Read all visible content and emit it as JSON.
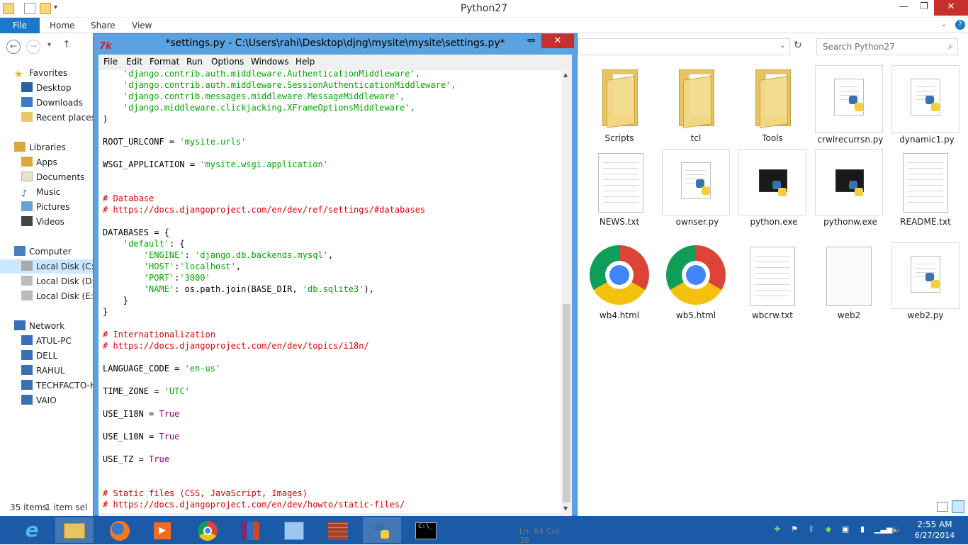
{
  "explorer": {
    "title": "Python27",
    "ribbon": {
      "file": "File",
      "tabs": [
        "Home",
        "Share",
        "View"
      ]
    },
    "search_placeholder": "Search Python27",
    "sidebar": {
      "favorites": {
        "label": "Favorites",
        "items": [
          "Desktop",
          "Downloads",
          "Recent places"
        ]
      },
      "libraries": {
        "label": "Libraries",
        "items": [
          "Apps",
          "Documents",
          "Music",
          "Pictures",
          "Videos"
        ]
      },
      "computer": {
        "label": "Computer",
        "items": [
          "Local Disk (C:)",
          "Local Disk (D:)",
          "Local Disk (E:)"
        ]
      },
      "network": {
        "label": "Network",
        "items": [
          "ATUL-PC",
          "DELL",
          "RAHUL",
          "TECHFACTO-H",
          "VAIO"
        ]
      }
    },
    "status": {
      "count": "35 items",
      "selected": "1 item sel"
    },
    "files": [
      {
        "name": "Scripts",
        "icon": "folder-icon"
      },
      {
        "name": "tcl",
        "icon": "folder-icon"
      },
      {
        "name": "Tools",
        "icon": "folder-icon"
      },
      {
        "name": "crwlrecurrsn.py",
        "icon": "python-file-icon"
      },
      {
        "name": "dynamic1.py",
        "icon": "python-file-icon"
      },
      {
        "name": "NEWS.txt",
        "icon": "text-file-icon"
      },
      {
        "name": "ownser.py",
        "icon": "python-file-icon"
      },
      {
        "name": "python.exe",
        "icon": "python-exe-icon"
      },
      {
        "name": "pythonw.exe",
        "icon": "python-exe-icon"
      },
      {
        "name": "README.txt",
        "icon": "text-file-icon"
      },
      {
        "name": "wb4.html",
        "icon": "chrome-icon"
      },
      {
        "name": "wb5.html",
        "icon": "chrome-icon"
      },
      {
        "name": "wbcrw.txt",
        "icon": "text-file-icon"
      },
      {
        "name": "web2",
        "icon": "blank-file-icon"
      },
      {
        "name": "web2.py",
        "icon": "python-file-icon"
      }
    ]
  },
  "idle": {
    "title": "*settings.py - C:\\Users\\rahi\\Desktop\\djng\\mysite\\mysite\\settings.py*",
    "menu": [
      "File",
      "Edit",
      "Format",
      "Run",
      "Options",
      "Windows",
      "Help"
    ],
    "status": "Ln: 64  Col: 38"
  },
  "code": {
    "l1": "'django.contrib.auth.middleware.AuthenticationMiddleware',",
    "l2": "'django.contrib.auth.middleware.SessionAuthenticationMiddleware',",
    "l3": "'django.contrib.messages.middleware.MessageMiddleware',",
    "l4": "'django.middleware.clickjacking.XFrameOptionsMiddleware',",
    "l5": ")",
    "root_k": "ROOT_URLCONF = ",
    "root_v": "'mysite.urls'",
    "wsgi_k": "WSGI_APPLICATION = ",
    "wsgi_v": "'mysite.wsgi.application'",
    "db_c1": "# Database",
    "db_c2": "# https://docs.djangoproject.com/en/dev/ref/settings/#databases",
    "db_open": "DATABASES = {",
    "default_k": "'default'",
    "default_rest": ": {",
    "engine_k": "'ENGINE'",
    "engine_sep": ": ",
    "engine_v": "'django.db.backends.mysql'",
    "engine_end": ",",
    "host_k": "'HOST'",
    "host_sep": ":",
    "host_v": "'localhost'",
    "host_end": ",",
    "port_k": "'PORT'",
    "port_sep": ":",
    "port_v": "'3000'",
    "name_k": "'NAME'",
    "name_mid": ": os.path.join(BASE_DIR, ",
    "name_v": "'db.sqlite3'",
    "name_end": "),",
    "inner_close": "}",
    "outer_close": "}",
    "i18n_c1": "# Internationalization",
    "i18n_c2": "# https://docs.djangoproject.com/en/dev/topics/i18n/",
    "lang_k": "LANGUAGE_CODE = ",
    "lang_v": "'en-us'",
    "tz_k": "TIME_ZONE = ",
    "tz_v": "'UTC'",
    "i18n_k": "USE_I18N = ",
    "l10n_k": "USE_L10N = ",
    "usetz_k": "USE_TZ = ",
    "true_v": "True",
    "static_c1": "# Static files (CSS, JavaScript, Images)",
    "static_c2": "# https://docs.djangoproject.com/en/dev/howto/static-files/"
  },
  "taskbar": {
    "apps": [
      "internet-explorer-icon",
      "file-explorer-icon",
      "firefox-icon",
      "media-player-icon",
      "chrome-icon",
      "winrar-icon",
      "control-panel-icon",
      "firewall-icon",
      "python-idle-icon",
      "command-prompt-icon"
    ],
    "time": "2:55 AM",
    "date": "6/27/2014"
  },
  "colors": {
    "accent": "#1979ca",
    "idle_frame": "#5aa2e0",
    "taskbar": "#1a5aa6",
    "string": "#00aa00",
    "comment": "#dd0000",
    "builtin": "#900090"
  }
}
